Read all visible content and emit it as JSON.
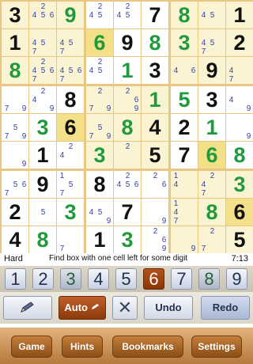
{
  "board": {
    "rows": [
      [
        {
          "v": "3",
          "t": "given"
        },
        {
          "c": [
            2,
            4,
            5,
            6
          ]
        },
        {
          "v": "9",
          "t": "user"
        },
        {
          "c": [
            2,
            4,
            5
          ]
        },
        {
          "c": [
            2,
            4,
            5
          ]
        },
        {
          "v": "7",
          "t": "given"
        },
        {
          "v": "8",
          "t": "user"
        },
        {
          "c": [
            4,
            5
          ]
        },
        {
          "v": "1",
          "t": "given"
        }
      ],
      [
        {
          "v": "1",
          "t": "given"
        },
        {
          "c": [
            4,
            5,
            7
          ]
        },
        {
          "c": [
            4,
            5,
            7
          ]
        },
        {
          "v": "6",
          "t": "user",
          "sel": true
        },
        {
          "v": "9",
          "t": "given"
        },
        {
          "v": "8",
          "t": "user"
        },
        {
          "v": "3",
          "t": "user"
        },
        {
          "c": [
            4,
            5,
            7
          ]
        },
        {
          "v": "2",
          "t": "given"
        }
      ],
      [
        {
          "v": "8",
          "t": "user"
        },
        {
          "c": [
            2,
            4,
            5,
            6,
            7
          ]
        },
        {
          "c": [
            4,
            5,
            6,
            7
          ]
        },
        {
          "c": [
            2,
            4,
            5
          ]
        },
        {
          "v": "1",
          "t": "user"
        },
        {
          "v": "3",
          "t": "given"
        },
        {
          "c": [
            4,
            6
          ]
        },
        {
          "v": "9",
          "t": "given"
        },
        {
          "c": [
            4,
            7
          ]
        }
      ],
      [
        {
          "c": [
            7,
            9
          ]
        },
        {
          "c": [
            2,
            4,
            9
          ]
        },
        {
          "v": "8",
          "t": "given"
        },
        {
          "c": [
            2,
            7,
            9
          ]
        },
        {
          "c": [
            2,
            6,
            9
          ]
        },
        {
          "v": "1",
          "t": "user"
        },
        {
          "v": "5",
          "t": "user"
        },
        {
          "v": "3",
          "t": "given"
        },
        {
          "c": [
            4,
            9
          ]
        }
      ],
      [
        {
          "c": [
            5,
            7,
            9
          ]
        },
        {
          "v": "3",
          "t": "user"
        },
        {
          "v": "6",
          "t": "given",
          "sel": true
        },
        {
          "c": [
            5,
            7,
            9
          ]
        },
        {
          "v": "8",
          "t": "user"
        },
        {
          "v": "4",
          "t": "given"
        },
        {
          "v": "2",
          "t": "given"
        },
        {
          "v": "1",
          "t": "user"
        },
        {
          "c": [
            9
          ]
        }
      ],
      [
        {
          "c": [
            9
          ]
        },
        {
          "v": "1",
          "t": "given"
        },
        {
          "c": [
            2,
            4
          ]
        },
        {
          "v": "3",
          "t": "user"
        },
        {
          "c": [
            2
          ]
        },
        {
          "v": "5",
          "t": "given"
        },
        {
          "v": "7",
          "t": "given"
        },
        {
          "v": "6",
          "t": "user",
          "sel": true
        },
        {
          "v": "8",
          "t": "user"
        }
      ],
      [
        {
          "c": [
            5,
            6,
            7
          ]
        },
        {
          "v": "9",
          "t": "given"
        },
        {
          "c": [
            1,
            5,
            7
          ]
        },
        {
          "v": "8",
          "t": "given"
        },
        {
          "c": [
            2,
            4,
            5,
            6
          ]
        },
        {
          "c": [
            2,
            6
          ]
        },
        {
          "c": [
            1,
            4
          ]
        },
        {
          "c": [
            2,
            4,
            7
          ]
        },
        {
          "v": "3",
          "t": "user"
        }
      ],
      [
        {
          "v": "2",
          "t": "given"
        },
        {
          "c": [
            5
          ]
        },
        {
          "v": "3",
          "t": "user"
        },
        {
          "c": [
            4,
            5,
            9
          ]
        },
        {
          "v": "7",
          "t": "given"
        },
        {
          "c": [
            9
          ]
        },
        {
          "c": [
            1,
            4,
            7
          ]
        },
        {
          "v": "8",
          "t": "user"
        },
        {
          "v": "6",
          "t": "given",
          "sel": true
        }
      ],
      [
        {
          "v": "4",
          "t": "given"
        },
        {
          "v": "8",
          "t": "user"
        },
        {
          "c": [
            7
          ]
        },
        {
          "v": "1",
          "t": "given"
        },
        {
          "v": "3",
          "t": "user"
        },
        {
          "c": [
            2,
            6,
            9
          ]
        },
        {
          "c": [
            9
          ]
        },
        {
          "c": [
            2,
            7
          ]
        },
        {
          "v": "5",
          "t": "given"
        }
      ]
    ],
    "highlight_boxes": [
      0,
      4,
      8,
      2
    ]
  },
  "status": {
    "level": "Hard",
    "hint": "Find box with one cell left for some digit",
    "timer": "7:13"
  },
  "number_strip": [
    {
      "label": "1",
      "state": "normal"
    },
    {
      "label": "2",
      "state": "normal"
    },
    {
      "label": "3",
      "state": "done"
    },
    {
      "label": "4",
      "state": "normal"
    },
    {
      "label": "5",
      "state": "normal"
    },
    {
      "label": "6",
      "state": "active"
    },
    {
      "label": "7",
      "state": "normal"
    },
    {
      "label": "8",
      "state": "done"
    },
    {
      "label": "9",
      "state": "normal"
    }
  ],
  "tools": {
    "pencil_icon": "pencil-icon",
    "auto_label": "Auto",
    "clear_symbol": "✕",
    "undo_label": "Undo",
    "redo_label": "Redo"
  },
  "tabbar": {
    "game": "Game",
    "hints": "Hints",
    "bookmarks": "Bookmarks",
    "settings": "Settings"
  },
  "colors": {
    "given": "#111111",
    "user": "#1f9a3c",
    "candidate": "#3440a8",
    "grid": "#e9c783",
    "active": "#a2470f"
  }
}
